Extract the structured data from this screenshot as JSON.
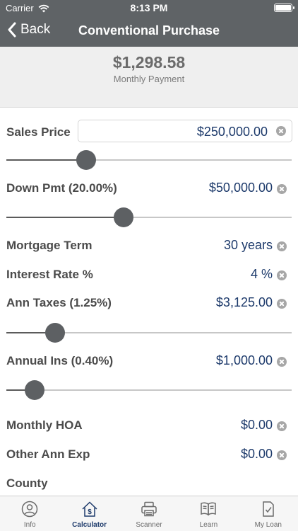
{
  "status_bar": {
    "carrier": "Carrier",
    "time": "8:13 PM"
  },
  "nav": {
    "back_label": "Back",
    "title": "Conventional Purchase"
  },
  "summary": {
    "amount": "$1,298.58",
    "label": "Monthly Payment"
  },
  "fields": {
    "sales_price": {
      "label": "Sales Price",
      "value": "$250,000.00",
      "slider_level": 0.28
    },
    "down_pmt": {
      "label": "Down Pmt (20.00%)",
      "value": "$50,000.00",
      "slider_level": 0.41
    },
    "mortgage_term": {
      "label": "Mortgage Term",
      "value": "30 years"
    },
    "interest_rate": {
      "label": "Interest Rate %",
      "value": "4 %"
    },
    "ann_taxes": {
      "label": "Ann Taxes (1.25%)",
      "value": "$3,125.00",
      "slider_level": 0.17
    },
    "annual_ins": {
      "label": "Annual Ins (0.40%)",
      "value": "$1,000.00",
      "slider_level": 0.1
    },
    "monthly_hoa": {
      "label": "Monthly HOA",
      "value": "$0.00"
    },
    "other_ann_exp": {
      "label": "Other Ann Exp",
      "value": "$0.00"
    },
    "county": {
      "label": "County"
    }
  },
  "tabbar": {
    "active": "calculator",
    "tabs": [
      {
        "id": "info",
        "label": "Info",
        "icon": "person-circle-icon"
      },
      {
        "id": "calculator",
        "label": "Calculator",
        "icon": "house-dollar-icon"
      },
      {
        "id": "scanner",
        "label": "Scanner",
        "icon": "printer-icon"
      },
      {
        "id": "learn",
        "label": "Learn",
        "icon": "open-book-icon"
      },
      {
        "id": "myloan",
        "label": "My Loan",
        "icon": "document-check-icon"
      }
    ]
  },
  "colors": {
    "header": "#5f6366",
    "value_text": "#1d3a6b",
    "label_text": "#4b4b4b",
    "slider_thumb": "#5d6063"
  }
}
